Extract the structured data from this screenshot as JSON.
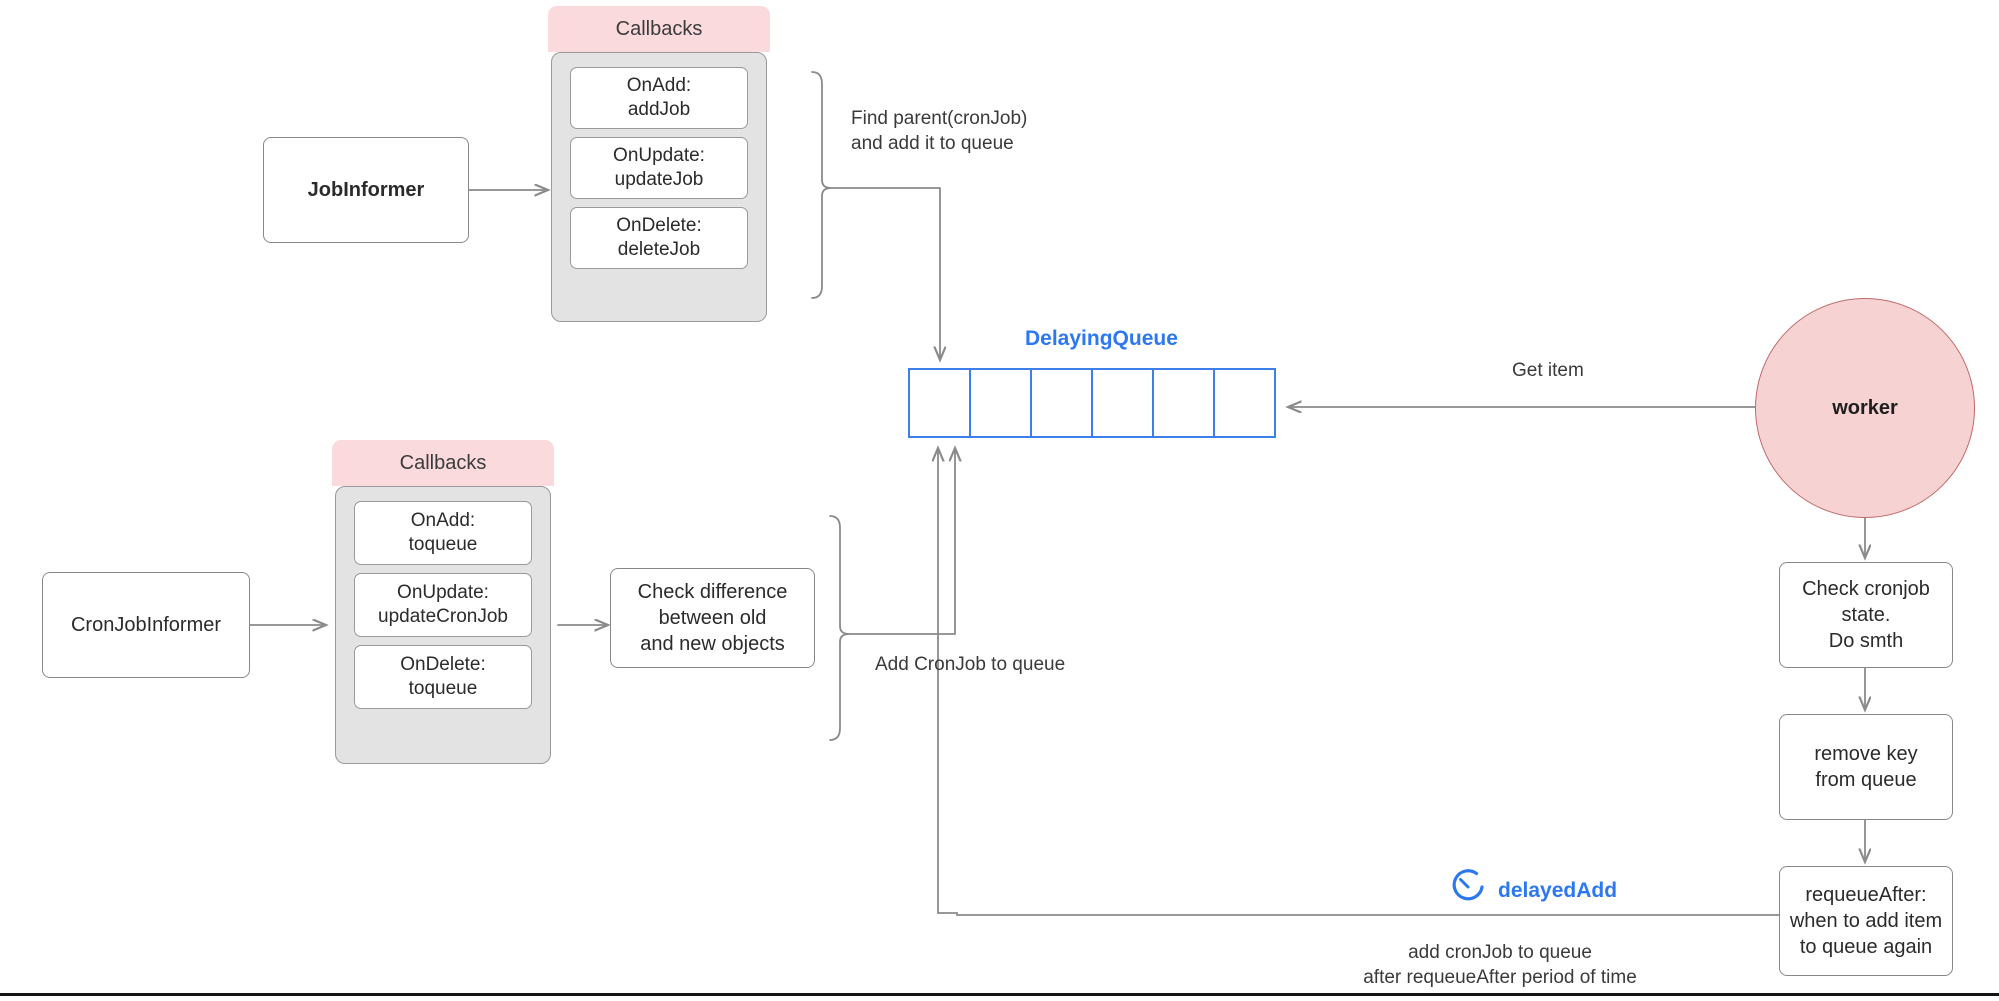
{
  "diagram": {
    "title": "Kubernetes CronJob controller informer / delaying queue flow",
    "colors": {
      "callbacks_header_bg": "#fadadd",
      "callbacks_body_bg": "#e3e3e3",
      "queue_border": "#3d7fe8",
      "queue_title": "#2c78f0",
      "worker_fill": "#f6d2d2",
      "worker_border": "#c06a6a",
      "box_border": "#888888",
      "arrow": "#8a8a8a",
      "text": "#2b2b2b"
    }
  },
  "job_flow": {
    "informer_label": "JobInformer",
    "callbacks_title": "Callbacks",
    "callbacks": [
      "OnAdd:\naddJob",
      "OnUpdate:\nupdateJob",
      "OnDelete:\ndeleteJob"
    ],
    "brace_label": "Find parent(cronJob)\nand add it to queue"
  },
  "cronjob_flow": {
    "informer_label": "CronJobInformer",
    "callbacks_title": "Callbacks",
    "callbacks": [
      "OnAdd:\ntoqueue",
      "OnUpdate:\nupdateCronJob",
      "OnDelete:\ntoqueue"
    ],
    "diff_box_label": "Check difference\nbetween old\nand new objects",
    "brace_label": "Add CronJob to queue"
  },
  "queue": {
    "title": "DelayingQueue",
    "cell_count": 6,
    "cells": [
      "",
      "",
      "",
      "",
      "",
      ""
    ]
  },
  "worker": {
    "label": "worker",
    "get_item_label": "Get item"
  },
  "worker_steps": [
    "Check cronjob state.\nDo smth",
    "remove key\nfrom queue",
    "requeueAfter:\nwhen to add item\nto queue again"
  ],
  "delayed_add": {
    "icon": "timer-clock-icon",
    "label": "delayedAdd",
    "caption": "add cronJob to queue\nafter requeueAfter period of time"
  }
}
